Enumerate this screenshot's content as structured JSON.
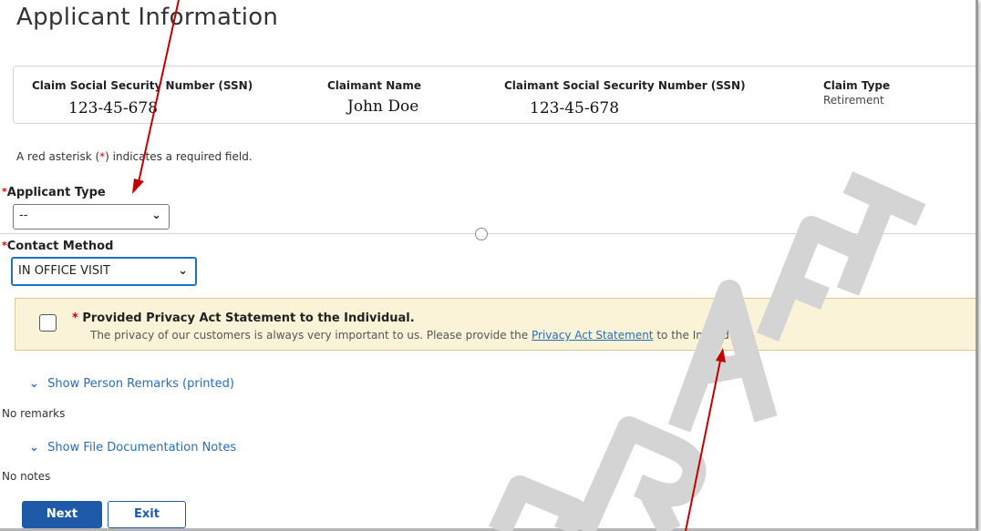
{
  "page_title": "Applicant Information",
  "claim_header": {
    "columns": [
      {
        "label": "Claim Social Security Number (SSN)",
        "value": "123-45-678"
      },
      {
        "label": "Claimant Name",
        "value": "John Doe"
      },
      {
        "label": "Claimant Social Security Number (SSN)",
        "value": "123-45-678"
      },
      {
        "label": "Claim Type",
        "value": "Retirement"
      }
    ]
  },
  "required_note": {
    "before": "A red asterisk (",
    "star": "*",
    "after": ") indicates a required field."
  },
  "applicant_type": {
    "star": "*",
    "label": "Applicant Type",
    "value": "--"
  },
  "contact_method": {
    "star": "*",
    "label": "Contact Method",
    "value": "IN OFFICE VISIT"
  },
  "privacy": {
    "star": "*",
    "title": "Provided Privacy Act Statement to the Individual.",
    "text_before": "The privacy of our customers is always very important to us. Please provide the ",
    "link": "Privacy Act Statement",
    "text_after": " to the Individual."
  },
  "person_remarks": {
    "toggle_label": "Show Person Remarks (printed)",
    "empty_text": "No remarks"
  },
  "file_notes": {
    "toggle_label": "Show File Documentation Notes",
    "empty_text": "No notes"
  },
  "buttons": {
    "next": "Next",
    "exit": "Exit"
  },
  "icons": {
    "dropdown": "chevron-down-icon",
    "expand": "chevron-down-icon"
  },
  "colors": {
    "accent": "#1f5aa8",
    "link": "#2a6db5",
    "required": "#d10000",
    "privacy_bg": "#fbf3d8",
    "annotation_arrow": "#c00000"
  }
}
